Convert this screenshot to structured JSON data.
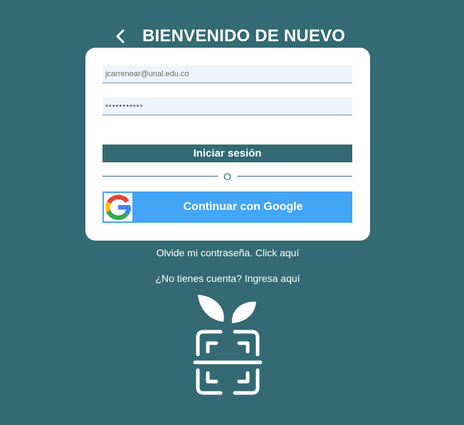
{
  "header": {
    "title": "BIENVENIDO DE NUEVO",
    "back_icon": "chevron-left-icon"
  },
  "form": {
    "email_value": "jcarrenoar@unal.edu.co",
    "password_value": "•••••••••••",
    "login_label": "Iniciar sesión",
    "divider_label": "O",
    "google_label": "Continuar con Google",
    "google_icon": "google-logo-icon"
  },
  "links": {
    "forgot_password": "Olvide mi contraseña. Click aquí",
    "signup": "¿No tienes cuenta? Ingresa aquí"
  },
  "logo": {
    "icon": "plant-scan-logo"
  },
  "colors": {
    "background": "#336a73",
    "card": "#ffffff",
    "input_bg": "#eef4fb",
    "primary_button": "#336a73",
    "google_button": "#42a5f5"
  }
}
